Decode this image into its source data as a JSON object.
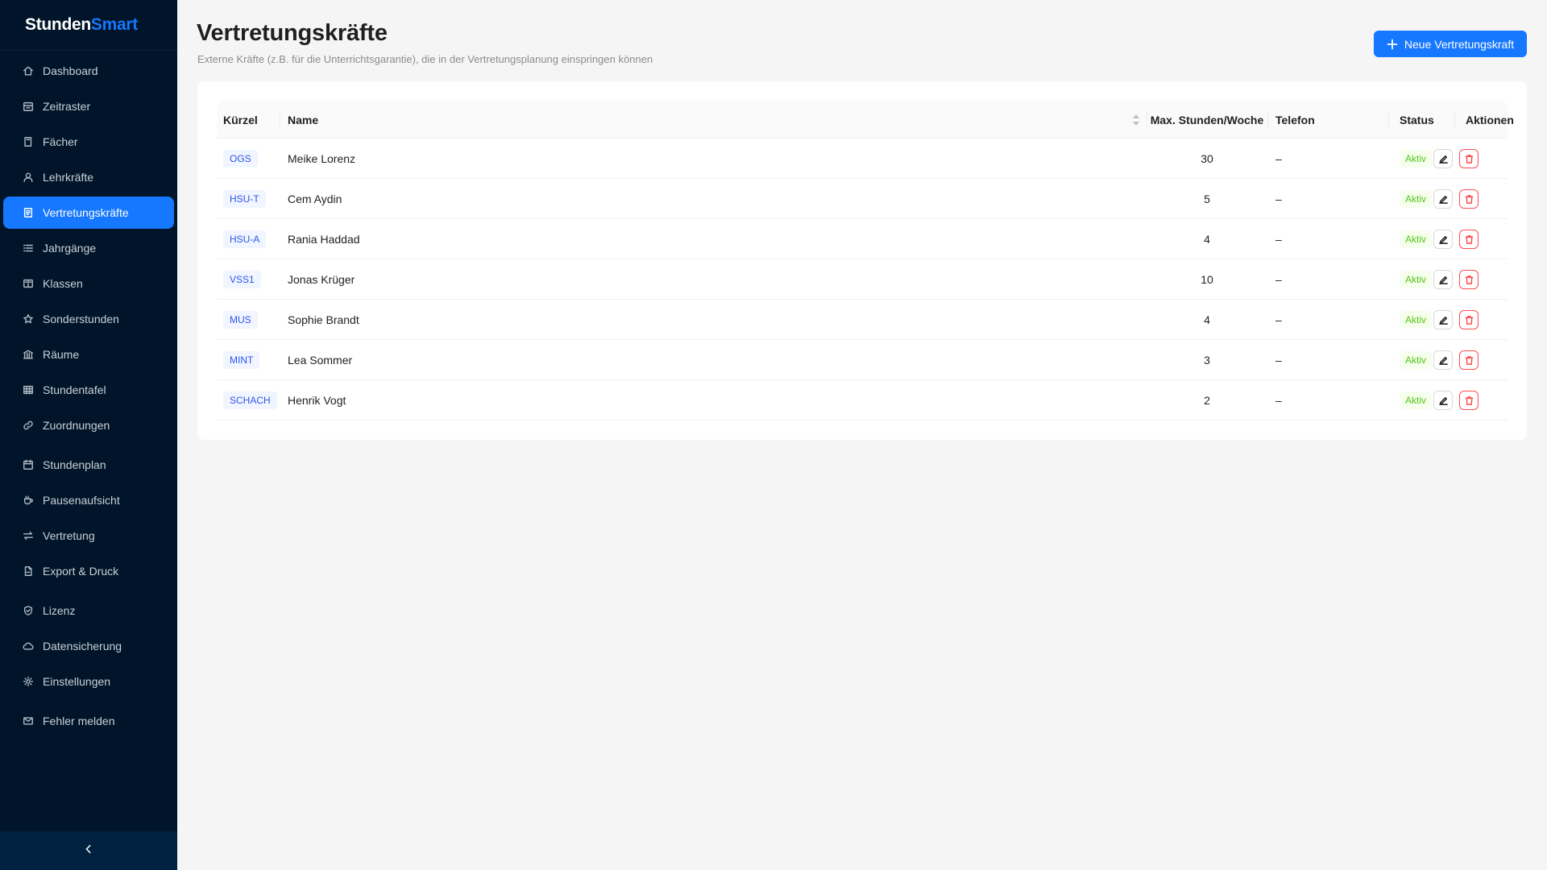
{
  "sidebar": {
    "logo": {
      "part1": "Stunden",
      "part2": "Smart"
    },
    "items": [
      {
        "label": "Dashboard",
        "icon": "home-icon"
      },
      {
        "label": "Zeitraster",
        "icon": "calendar-grid-icon"
      },
      {
        "label": "Fächer",
        "icon": "book-icon"
      },
      {
        "label": "Lehrkräfte",
        "icon": "user-icon"
      },
      {
        "label": "Vertretungskräfte",
        "icon": "id-card-icon",
        "active": true
      },
      {
        "label": "Jahrgänge",
        "icon": "list-icon"
      },
      {
        "label": "Klassen",
        "icon": "book-open-icon"
      },
      {
        "label": "Sonderstunden",
        "icon": "star-icon"
      },
      {
        "label": "Räume",
        "icon": "building-icon"
      },
      {
        "label": "Stundentafel",
        "icon": "table-icon"
      },
      {
        "label": "Zuordnungen",
        "icon": "link-icon"
      },
      {
        "label": "Stundenplan",
        "icon": "calendar-icon"
      },
      {
        "label": "Pausenaufsicht",
        "icon": "coffee-icon"
      },
      {
        "label": "Vertretung",
        "icon": "swap-icon"
      },
      {
        "label": "Export & Druck",
        "icon": "file-export-icon"
      },
      {
        "label": "Lizenz",
        "icon": "shield-check-icon"
      },
      {
        "label": "Datensicherung",
        "icon": "cloud-icon"
      },
      {
        "label": "Einstellungen",
        "icon": "gear-icon"
      },
      {
        "label": "Fehler melden",
        "icon": "mail-icon"
      }
    ],
    "collapse_icon": "chevron-left-icon"
  },
  "header": {
    "title": "Vertretungskräfte",
    "subtitle": "Externe Kräfte (z.B. für die Unterrichtsgarantie), die in der Vertretungsplanung einspringen können",
    "new_button_label": "Neue Vertretungskraft"
  },
  "table": {
    "columns": {
      "kuerzel": "Kürzel",
      "name": "Name",
      "max_hours": "Max. Stunden/Woche",
      "phone": "Telefon",
      "status": "Status",
      "actions": "Aktionen"
    },
    "rows": [
      {
        "kuerzel": "OGS",
        "name": "Meike Lorenz",
        "max_hours": "30",
        "phone": "–",
        "status": "Aktiv"
      },
      {
        "kuerzel": "HSU-T",
        "name": "Cem Aydin",
        "max_hours": "5",
        "phone": "–",
        "status": "Aktiv"
      },
      {
        "kuerzel": "HSU-A",
        "name": "Rania Haddad",
        "max_hours": "4",
        "phone": "–",
        "status": "Aktiv"
      },
      {
        "kuerzel": "VSS1",
        "name": "Jonas Krüger",
        "max_hours": "10",
        "phone": "–",
        "status": "Aktiv"
      },
      {
        "kuerzel": "MUS",
        "name": "Sophie Brandt",
        "max_hours": "4",
        "phone": "–",
        "status": "Aktiv"
      },
      {
        "kuerzel": "MINT",
        "name": "Lea Sommer",
        "max_hours": "3",
        "phone": "–",
        "status": "Aktiv"
      },
      {
        "kuerzel": "SCHACH",
        "name": "Henrik Vogt",
        "max_hours": "2",
        "phone": "–",
        "status": "Aktiv"
      }
    ]
  },
  "colors": {
    "primary": "#1677ff",
    "sidebar_bg": "#001529",
    "status_active": "#52c41a",
    "danger": "#ff4d4f",
    "tag_text": "#2f54eb"
  }
}
